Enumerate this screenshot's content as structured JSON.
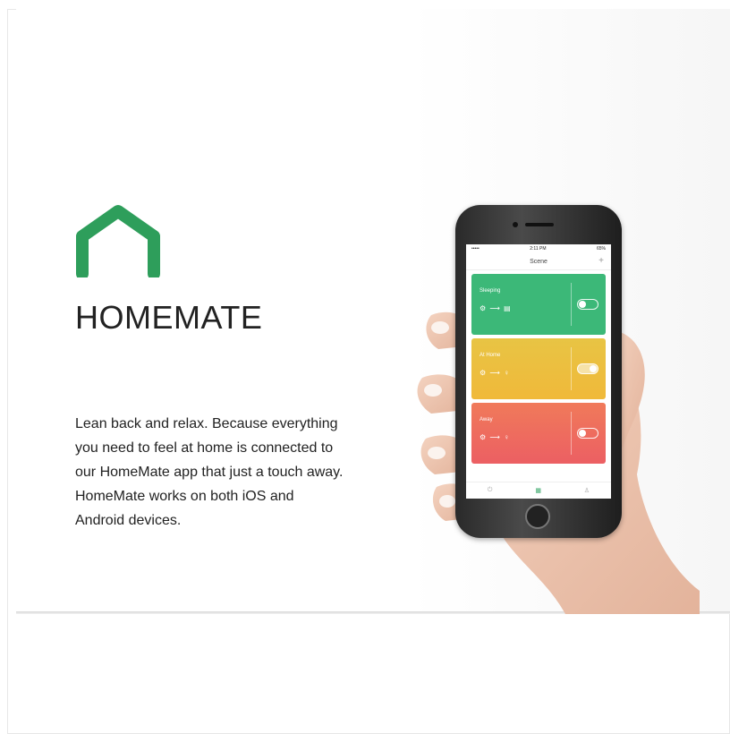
{
  "brand": {
    "name": "HOMEMATE",
    "logo_color": "#2e9e5b"
  },
  "description": [
    "Lean back and relax.  Because everything",
    "you need to feel at home is connected to",
    "our HomeMate app that just a touch away.",
    "HomeMate works on both iOS and",
    "Android devices."
  ],
  "phone": {
    "status_bar": {
      "signal": "••••• ",
      "time": "2:11 PM",
      "battery": "65%"
    },
    "nav_title": "Scene",
    "add_label": "+",
    "scenes": [
      {
        "name": "Sleeping",
        "flow": "⚙ ⟶ ▤",
        "color": "#3cb878",
        "toggle": "off"
      },
      {
        "name": "At Home",
        "flow": "⚙ ⟶ ♀",
        "color": "#ecc63f",
        "toggle": "on"
      },
      {
        "name": "Away",
        "flow": "⚙ ⟶ ♀",
        "color": "#ee6a5a",
        "toggle": "off"
      }
    ],
    "tabs": [
      {
        "icon": "power-icon",
        "glyph": "⏻"
      },
      {
        "icon": "scene-icon",
        "glyph": "▦"
      },
      {
        "icon": "profile-icon",
        "glyph": "♙"
      }
    ]
  }
}
